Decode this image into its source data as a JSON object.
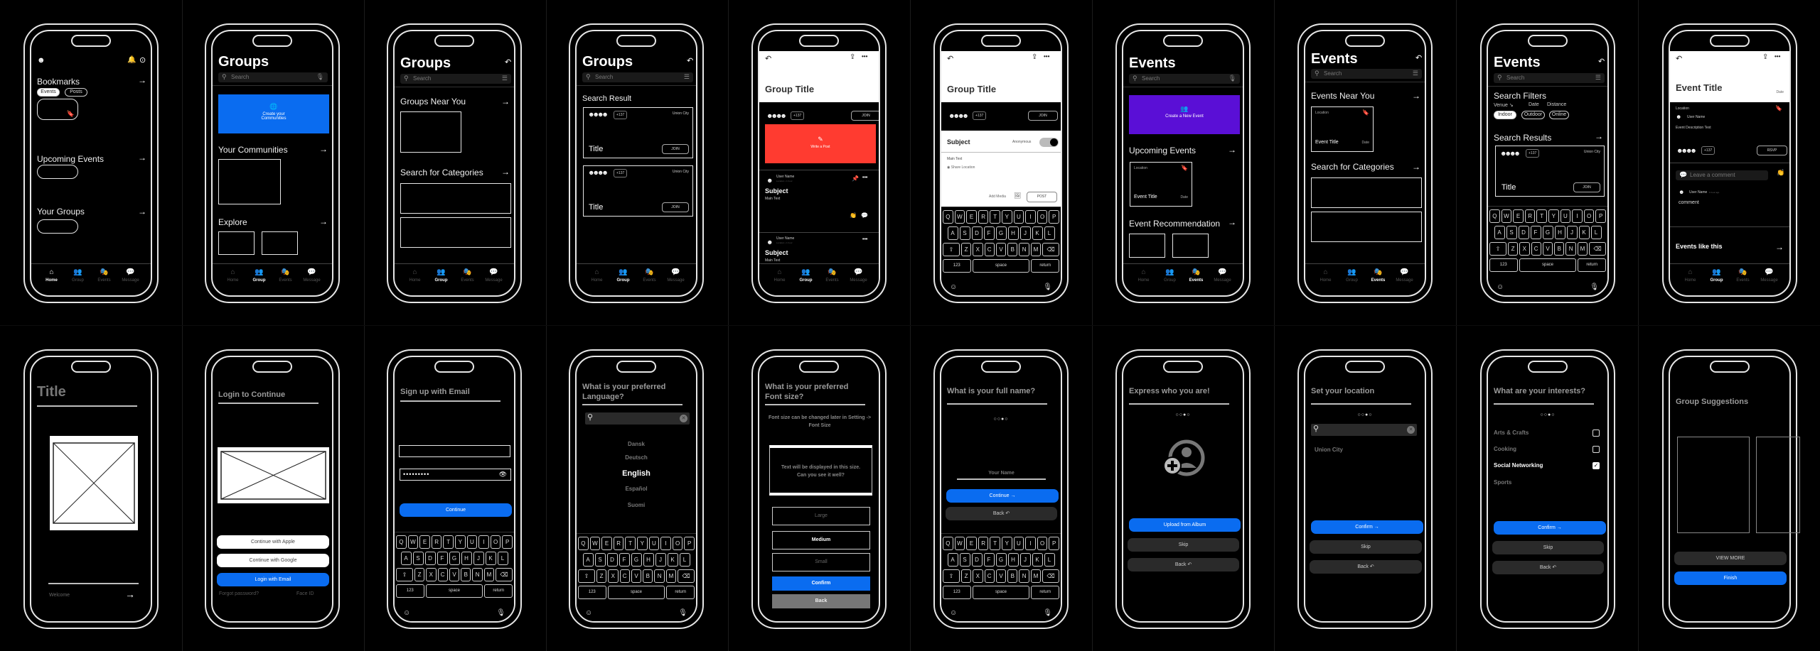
{
  "common": {
    "tabs": [
      {
        "label": "Home",
        "icon": "home-icon",
        "glyph": "⌂"
      },
      {
        "label": "Group",
        "icon": "group-icon",
        "glyph": "👥"
      },
      {
        "label": "Events",
        "icon": "theater-masks-icon",
        "glyph": "🎭"
      },
      {
        "label": "Message",
        "icon": "message-icon",
        "glyph": "💬"
      }
    ],
    "search_placeholder": "Search",
    "arrow": "→",
    "back_glyph": "↶",
    "more_glyph": "•••",
    "share_glyph": "⇪",
    "avatar_stack": "☻☻☻☻",
    "member_count": "+137",
    "join_label": "JOIN",
    "keyboard": {
      "row1": [
        "Q",
        "W",
        "E",
        "R",
        "T",
        "Y",
        "U",
        "I",
        "O",
        "P"
      ],
      "row2": [
        "A",
        "S",
        "D",
        "F",
        "G",
        "H",
        "J",
        "K",
        "L"
      ],
      "row3": [
        "Z",
        "X",
        "C",
        "V",
        "B",
        "N",
        "M"
      ],
      "shift": "⇧",
      "delete": "⌫",
      "numbers": "123",
      "space": "space",
      "return": "return",
      "emoji": "☺",
      "mic": "🎙"
    }
  },
  "screens": {
    "home": {
      "sections": {
        "bookmarks": "Bookmarks",
        "upcoming": "Upcoming Events",
        "groups": "Your Groups"
      },
      "chips": [
        "Events",
        "Posts"
      ],
      "active_tab": "Home"
    },
    "groups_main": {
      "title": "Groups",
      "create_label": "Create your Communities",
      "create_color": "#0a6cf0",
      "sections": {
        "communities": "Your Communities",
        "explore": "Explore"
      },
      "active_tab": "Group"
    },
    "groups_browse": {
      "title": "Groups",
      "sections": {
        "near": "Groups Near You",
        "categories": "Search for Categories"
      },
      "active_tab": "Group"
    },
    "groups_results": {
      "title": "Groups",
      "section": "Search Result",
      "cards": [
        {
          "title": "Title",
          "location": "Union City"
        },
        {
          "title": "Title",
          "location": "Union City"
        }
      ],
      "active_tab": "Group"
    },
    "group_detail": {
      "title": "Group Title",
      "write_post": "Write a Post",
      "write_color": "#ff3b30",
      "posts": [
        {
          "user": "User Name",
          "meta": "Location • 1 hour",
          "subject": "Subject",
          "text": "Main Text",
          "pinned": true
        },
        {
          "user": "User Name",
          "meta": "Location • 1 hour",
          "subject": "Subject",
          "text": "Main Text",
          "pinned": false
        }
      ],
      "active_tab": "Group"
    },
    "group_compose": {
      "title": "Group Title",
      "subject": "Subject",
      "anonymous_label": "Anonymous",
      "anonymous_on": true,
      "main_text": "Main Text",
      "share_location": "Share Location",
      "add_media": "Add Media",
      "post_label": "POST"
    },
    "events_main": {
      "title": "Events",
      "create_label": "Create a New Event",
      "create_color": "#5a0fd6",
      "sections": {
        "upcoming": "Upcoming Events",
        "recommendation": "Event Recommendation"
      },
      "card": {
        "location": "Location",
        "title": "Event Title",
        "date": "Date"
      },
      "active_tab": "Events"
    },
    "events_browse": {
      "title": "Events",
      "sections": {
        "near": "Events Near You",
        "categories": "Search for Categories"
      },
      "card": {
        "location": "Location",
        "title": "Event Title",
        "date": "Date"
      },
      "active_tab": "Events"
    },
    "events_filter": {
      "title": "Events",
      "filters_heading": "Search Filters",
      "filter_tabs": [
        "Venue ↘",
        "Date",
        "Distance"
      ],
      "chips": [
        {
          "label": "Indoor",
          "selected": true
        },
        {
          "label": "Outdoor",
          "selected": false
        },
        {
          "label": "Online",
          "selected": false
        }
      ],
      "results_heading": "Search Results",
      "card": {
        "title": "Title",
        "location": "Union City"
      }
    },
    "event_detail": {
      "title": "Event Title",
      "date": "Date",
      "location": "Location",
      "host": "User Name",
      "description": "Event Description Text",
      "rsvp_label": "RSVP",
      "comment_placeholder": "Leave a comment",
      "comment": {
        "user": "User Name",
        "time": "1 hour ago",
        "text": "comment"
      },
      "similar": "Events like this",
      "active_tab": "Group"
    },
    "welcome": {
      "title": "Title",
      "footer": "Welcome"
    },
    "login": {
      "title": "Login to Continue",
      "apple": "Continue with Apple",
      "google": "Continue with Google",
      "email": "Login with Email",
      "forgot": "Forgot password?",
      "face_id": "Face ID"
    },
    "signup": {
      "title": "Sign up with Email",
      "email_value": "",
      "password_mask": "•••••••••",
      "continue": "Continue"
    },
    "language": {
      "title": "What is your preferred Language?",
      "options": [
        "Dansk",
        "Deutsch",
        "English",
        "Español",
        "Suomi"
      ],
      "selected": "English"
    },
    "font_size": {
      "title": "What is your preferred Font size?",
      "hint": "Font size can be changed later in Setting -> Font Size",
      "preview": "Text will be displayed in this size. Can you see it well?",
      "options": [
        "Large",
        "Medium",
        "Small"
      ],
      "selected": "Medium",
      "confirm": "Confirm",
      "back": "Back"
    },
    "full_name": {
      "title": "What is your full name?",
      "steps": "○○●○",
      "placeholder": "Your Name",
      "continue": "Continue →",
      "back": "Back ↶"
    },
    "avatar": {
      "title": "Express who you are!",
      "steps": "○○●○",
      "upload": "Upload from Album",
      "skip": "Skip",
      "back": "Back ↶"
    },
    "location": {
      "title": "Set your location",
      "steps": "○○●○",
      "result": "Union City",
      "confirm": "Confirm →",
      "skip": "Skip",
      "back": "Back ↶"
    },
    "interests": {
      "title": "What are your interests?",
      "steps": "○○●○",
      "options": [
        {
          "label": "Arts & Crafts",
          "checked": false
        },
        {
          "label": "Cooking",
          "checked": false
        },
        {
          "label": "Social Networking",
          "checked": true
        },
        {
          "label": "Sports",
          "checked": null
        }
      ],
      "confirm": "Confirm →",
      "skip": "Skip",
      "back": "Back ↶"
    },
    "suggestions": {
      "title": "Group Suggestions",
      "view_more": "VIEW MORE",
      "finish": "Finish"
    }
  }
}
